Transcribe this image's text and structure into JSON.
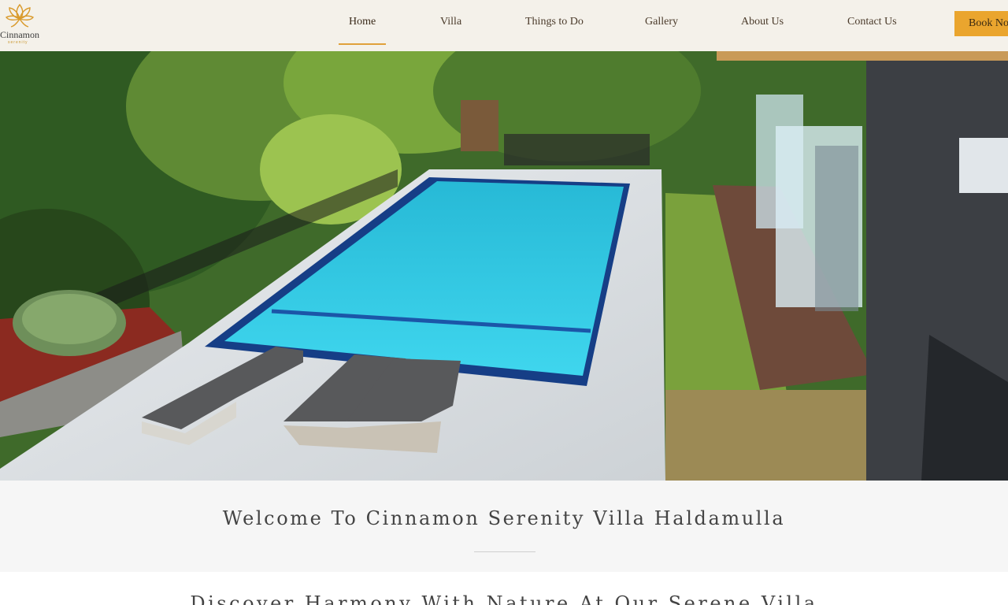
{
  "brand": {
    "name": "Cinnamon",
    "tagline": "serenity"
  },
  "nav": {
    "items": [
      {
        "label": "Home"
      },
      {
        "label": "Villa"
      },
      {
        "label": "Things to Do"
      },
      {
        "label": "Gallery"
      },
      {
        "label": "About Us"
      },
      {
        "label": "Contact Us"
      }
    ],
    "active": "Home",
    "cta": "Book Now"
  },
  "hero": {
    "image": "aerial-pool-villa-photo"
  },
  "welcome": {
    "title": "Welcome To Cinnamon Serenity Villa Haldamulla"
  },
  "intro": {
    "heading": "Discover Harmony With Nature At Our Serene Villa"
  },
  "colors": {
    "accent": "#eaa52e",
    "pool": "#2ec3de",
    "header_bg": "#f4f1ea"
  }
}
